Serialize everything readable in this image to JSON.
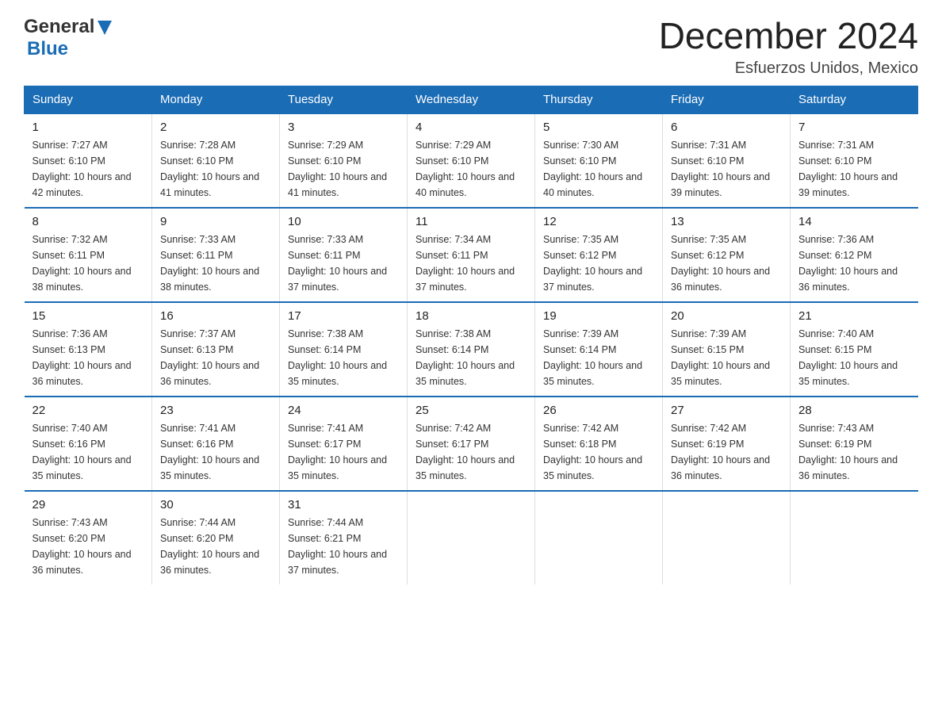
{
  "header": {
    "logo_general": "General",
    "logo_blue": "Blue",
    "month_title": "December 2024",
    "location": "Esfuerzos Unidos, Mexico"
  },
  "calendar": {
    "days_of_week": [
      "Sunday",
      "Monday",
      "Tuesday",
      "Wednesday",
      "Thursday",
      "Friday",
      "Saturday"
    ],
    "weeks": [
      [
        {
          "day": "1",
          "sunrise": "7:27 AM",
          "sunset": "6:10 PM",
          "daylight": "10 hours and 42 minutes."
        },
        {
          "day": "2",
          "sunrise": "7:28 AM",
          "sunset": "6:10 PM",
          "daylight": "10 hours and 41 minutes."
        },
        {
          "day": "3",
          "sunrise": "7:29 AM",
          "sunset": "6:10 PM",
          "daylight": "10 hours and 41 minutes."
        },
        {
          "day": "4",
          "sunrise": "7:29 AM",
          "sunset": "6:10 PM",
          "daylight": "10 hours and 40 minutes."
        },
        {
          "day": "5",
          "sunrise": "7:30 AM",
          "sunset": "6:10 PM",
          "daylight": "10 hours and 40 minutes."
        },
        {
          "day": "6",
          "sunrise": "7:31 AM",
          "sunset": "6:10 PM",
          "daylight": "10 hours and 39 minutes."
        },
        {
          "day": "7",
          "sunrise": "7:31 AM",
          "sunset": "6:10 PM",
          "daylight": "10 hours and 39 minutes."
        }
      ],
      [
        {
          "day": "8",
          "sunrise": "7:32 AM",
          "sunset": "6:11 PM",
          "daylight": "10 hours and 38 minutes."
        },
        {
          "day": "9",
          "sunrise": "7:33 AM",
          "sunset": "6:11 PM",
          "daylight": "10 hours and 38 minutes."
        },
        {
          "day": "10",
          "sunrise": "7:33 AM",
          "sunset": "6:11 PM",
          "daylight": "10 hours and 37 minutes."
        },
        {
          "day": "11",
          "sunrise": "7:34 AM",
          "sunset": "6:11 PM",
          "daylight": "10 hours and 37 minutes."
        },
        {
          "day": "12",
          "sunrise": "7:35 AM",
          "sunset": "6:12 PM",
          "daylight": "10 hours and 37 minutes."
        },
        {
          "day": "13",
          "sunrise": "7:35 AM",
          "sunset": "6:12 PM",
          "daylight": "10 hours and 36 minutes."
        },
        {
          "day": "14",
          "sunrise": "7:36 AM",
          "sunset": "6:12 PM",
          "daylight": "10 hours and 36 minutes."
        }
      ],
      [
        {
          "day": "15",
          "sunrise": "7:36 AM",
          "sunset": "6:13 PM",
          "daylight": "10 hours and 36 minutes."
        },
        {
          "day": "16",
          "sunrise": "7:37 AM",
          "sunset": "6:13 PM",
          "daylight": "10 hours and 36 minutes."
        },
        {
          "day": "17",
          "sunrise": "7:38 AM",
          "sunset": "6:14 PM",
          "daylight": "10 hours and 35 minutes."
        },
        {
          "day": "18",
          "sunrise": "7:38 AM",
          "sunset": "6:14 PM",
          "daylight": "10 hours and 35 minutes."
        },
        {
          "day": "19",
          "sunrise": "7:39 AM",
          "sunset": "6:14 PM",
          "daylight": "10 hours and 35 minutes."
        },
        {
          "day": "20",
          "sunrise": "7:39 AM",
          "sunset": "6:15 PM",
          "daylight": "10 hours and 35 minutes."
        },
        {
          "day": "21",
          "sunrise": "7:40 AM",
          "sunset": "6:15 PM",
          "daylight": "10 hours and 35 minutes."
        }
      ],
      [
        {
          "day": "22",
          "sunrise": "7:40 AM",
          "sunset": "6:16 PM",
          "daylight": "10 hours and 35 minutes."
        },
        {
          "day": "23",
          "sunrise": "7:41 AM",
          "sunset": "6:16 PM",
          "daylight": "10 hours and 35 minutes."
        },
        {
          "day": "24",
          "sunrise": "7:41 AM",
          "sunset": "6:17 PM",
          "daylight": "10 hours and 35 minutes."
        },
        {
          "day": "25",
          "sunrise": "7:42 AM",
          "sunset": "6:17 PM",
          "daylight": "10 hours and 35 minutes."
        },
        {
          "day": "26",
          "sunrise": "7:42 AM",
          "sunset": "6:18 PM",
          "daylight": "10 hours and 35 minutes."
        },
        {
          "day": "27",
          "sunrise": "7:42 AM",
          "sunset": "6:19 PM",
          "daylight": "10 hours and 36 minutes."
        },
        {
          "day": "28",
          "sunrise": "7:43 AM",
          "sunset": "6:19 PM",
          "daylight": "10 hours and 36 minutes."
        }
      ],
      [
        {
          "day": "29",
          "sunrise": "7:43 AM",
          "sunset": "6:20 PM",
          "daylight": "10 hours and 36 minutes."
        },
        {
          "day": "30",
          "sunrise": "7:44 AM",
          "sunset": "6:20 PM",
          "daylight": "10 hours and 36 minutes."
        },
        {
          "day": "31",
          "sunrise": "7:44 AM",
          "sunset": "6:21 PM",
          "daylight": "10 hours and 37 minutes."
        },
        null,
        null,
        null,
        null
      ]
    ]
  }
}
